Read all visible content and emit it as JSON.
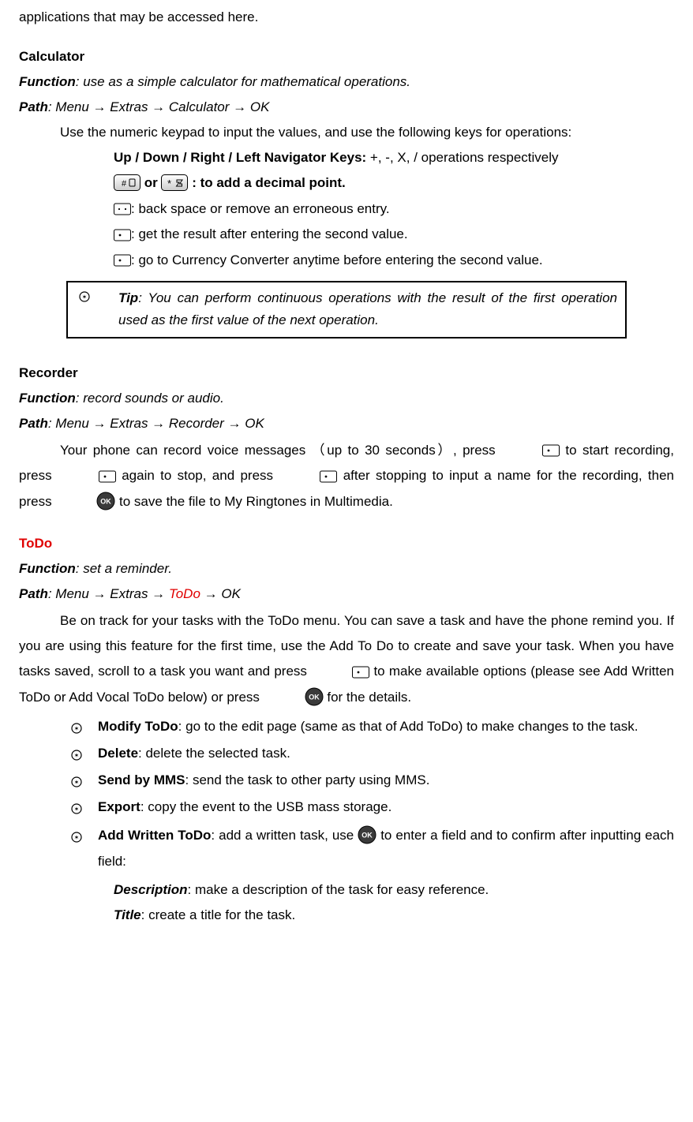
{
  "intro_fragment": "applications that may be accessed here.",
  "calc": {
    "heading": "Calculator",
    "function_label": "Function",
    "function_text": ": use as a simple calculator for mathematical operations.",
    "path_label": "Path",
    "path_text": ": Menu → Extras → Calculator → OK",
    "body": "Use the numeric keypad to input the values, and use the following keys for operations:",
    "keys_heading": "Up / Down / Right / Left Navigator Keys: ",
    "keys_tail": "+, -, X, / operations respectively",
    "or_word": " or ",
    "decimal_line": ": to add a decimal point.",
    "backspace_line": ": back space or remove an erroneous entry.",
    "result_line": ": get the result after entering the second value.",
    "currency_line": ": go to Currency Converter anytime before entering the second value.",
    "tip_label": "Tip",
    "tip_text": ": You can perform continuous operations with the result of the first operation used as the first value of the next operation."
  },
  "recorder": {
    "heading": "Recorder",
    "function_label": "Function",
    "function_text": ": record sounds or audio.",
    "path_label": "Path",
    "path_text": ": Menu → Extras → Recorder → OK",
    "b1": "Your phone can record voice messages （up to 30 seconds）, press ",
    "b2": " to start recording, press ",
    "b3": " again to stop, and press ",
    "b4": " after stopping to input a name for the recording, then press ",
    "b5": " to save the file to My Ringtones in Multimedia."
  },
  "todo": {
    "heading": "ToDo",
    "function_label": "Function",
    "function_text": ": set a reminder.",
    "path_label": "Path",
    "path_pre": ": Menu → Extras → ",
    "path_red": "ToDo",
    "path_post": " → OK",
    "b1": "Be on track for your tasks with the ToDo menu. You can save a task and have the phone remind you. If you are using this feature for the first time, use the Add To Do to create and save your task. When you have tasks saved, scroll to a task you want and press ",
    "b2": " to make available options (please see Add Written ToDo or Add Vocal ToDo below) or press ",
    "b3": " for the details.",
    "items": [
      {
        "label": "Modify ToDo",
        "text": ": go to the edit page (same as that of Add ToDo) to make changes to the task."
      },
      {
        "label": "Delete",
        "text": ": delete the selected task."
      },
      {
        "label": "Send by MMS",
        "text": ": send the task to other party using MMS."
      },
      {
        "label": "Export",
        "text": ": copy the event to the USB mass storage."
      }
    ],
    "add_written": {
      "label": "Add Written ToDo",
      "pre": ": add a written task, use ",
      "post": " to enter a field and to confirm after inputting each field:",
      "desc_label": "Description",
      "desc_text": ": make a description of the task for easy reference.",
      "title_label": "Title",
      "title_text": ": create a title for the task."
    }
  }
}
